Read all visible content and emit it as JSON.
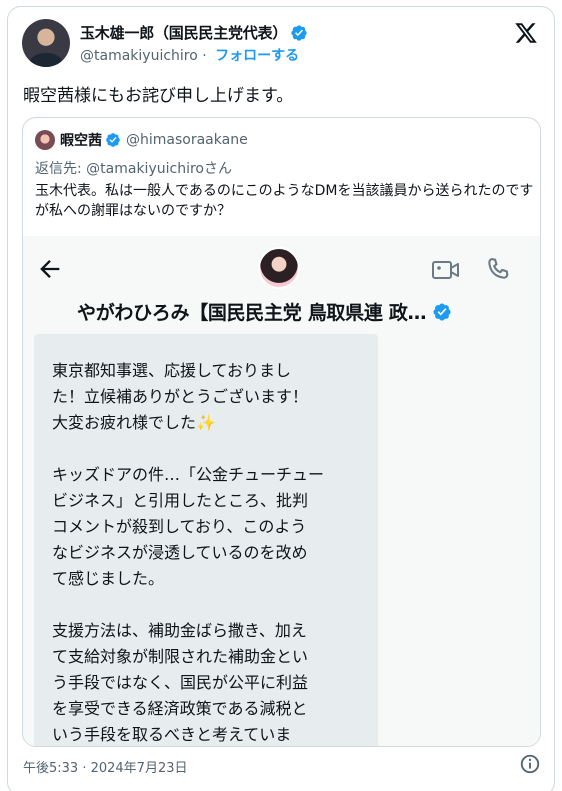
{
  "author": {
    "name": "玉木雄一郎（国民民主党代表）",
    "handle": "@tamakiyuichiro",
    "separator": "·",
    "follow_label": "フォローする"
  },
  "tweet_text": "暇空茜様にもお詫び申し上げます。",
  "quote": {
    "name": "暇空茜",
    "handle": "@himasoraakane",
    "reply_to": "返信先: @tamakiyuichiroさん",
    "body": "玉木代表。私は一般人であるのにこのようなDMを当該議員から送られたのですが私への謝罪はないのですか？",
    "dm": {
      "contact_name": "やがわひろみ【国民民主党 鳥取県連 政…",
      "paragraphs": [
        "東京都知事選、応援しておりまし\nた！立候補ありがとうございます！\n大変お疲れ様でした✨",
        "キッズドアの件…「公金チューチュー\nビジネス」と引用したところ、批判\nコメントが殺到しており、このよう\nなビジネスが浸透しているのを改め\nて感じました。",
        "支援方法は、補助金ばら撒き、加え\nて支給対象が制限された補助金とい\nう手段ではなく、国民が公平に利益\nを享受できる経済政策である減税と\nいう手段を取るべきと考えていま\nす。"
      ]
    }
  },
  "timestamp": "午後5:33 · 2024年7月23日",
  "colors": {
    "accent": "#1d9bf0",
    "muted": "#536471",
    "border": "#cfd9de"
  },
  "icons": [
    "verified-badge-icon",
    "x-logo-icon",
    "back-arrow-icon",
    "video-call-icon",
    "phone-icon",
    "info-icon"
  ]
}
